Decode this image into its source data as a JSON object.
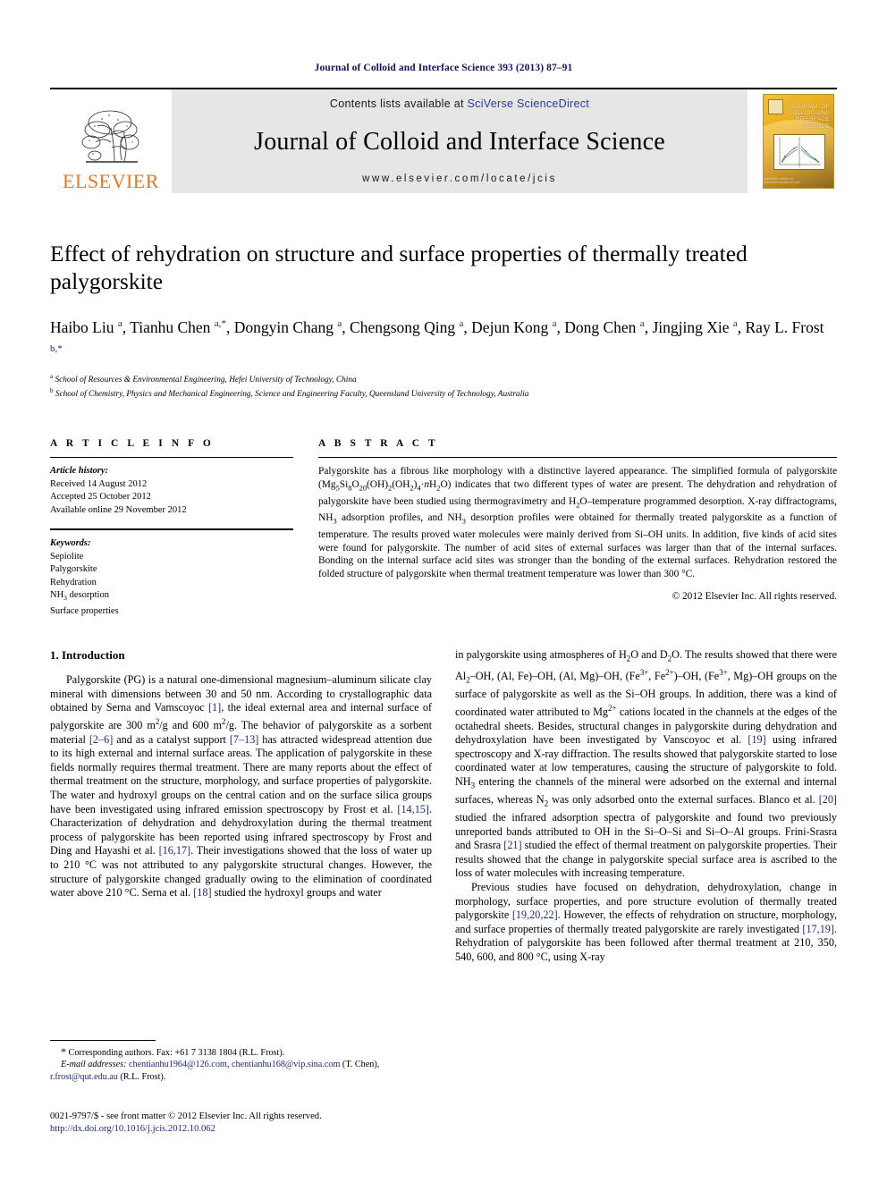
{
  "running_head": "Journal of Colloid and Interface Science 393 (2013) 87–91",
  "masthead": {
    "publisher_word": "ELSEVIER",
    "contents_prefix": "Contents lists available at ",
    "contents_link": "SciVerse ScienceDirect",
    "journal_title": "Journal of Colloid and Interface Science",
    "journal_url": "www.elsevier.com/locate/jcis",
    "cover_title": "JOURNAL OF\nCOLLOID AND\nINTERFACE\nSCIENCE",
    "cover_footer": "Available online at www.sciencedirect.com"
  },
  "article": {
    "title": "Effect of rehydration on structure and surface properties of thermally treated palygorskite",
    "authors_html": "Haibo Liu <sup>a</sup>, Tianhu Chen <sup>a,*</sup>, Dongyin Chang <sup>a</sup>, Chengsong Qing <sup>a</sup>, Dejun Kong <sup>a</sup>, Dong Chen <sup>a</sup>, Jingjing Xie <sup>a</sup>, Ray L. Frost <sup>b,*</sup>",
    "affiliations": [
      {
        "marker": "a",
        "text": "School of Resources & Environmental Engineering, Hefei University of Technology, China"
      },
      {
        "marker": "b",
        "text": "School of Chemistry, Physics and Mechanical Engineering, Science and Engineering Faculty, Queensland University of Technology, Australia"
      }
    ]
  },
  "article_info": {
    "heading": "A R T I C L E    I N F O",
    "history_label": "Article history:",
    "history": [
      "Received 14 August 2012",
      "Accepted 25 October 2012",
      "Available online 29 November 2012"
    ],
    "keywords_label": "Keywords:",
    "keywords_html": [
      "Sepiolite",
      "Palygorskite",
      "Rehydration",
      "NH<sub>3</sub> desorption",
      "Surface properties"
    ]
  },
  "abstract": {
    "heading": "A B S T R A C T",
    "text_html": "Palygorskite has a fibrous like morphology with a distinctive layered appearance. The simplified formula of palygorskite (Mg<sub>5</sub>Si<sub>8</sub>O<sub>20</sub>(OH)<sub>2</sub>(OH<sub>2</sub>)<sub>4</sub>·<i>n</i>H<sub>2</sub>O) indicates that two different types of water are present. The dehydration and rehydration of palygorskite have been studied using thermogravimetry and H<sub>2</sub>O–temperature programmed desorption. X-ray diffractograms, NH<sub>3</sub> adsorption profiles, and NH<sub>3</sub> desorption profiles were obtained for thermally treated palygorskite as a function of temperature. The results proved water molecules were mainly derived from Si–OH units. In addition, five kinds of acid sites were found for palygorskite. The number of acid sites of external surfaces was larger than that of the internal surfaces. Bonding on the internal surface acid sites was stronger than the bonding of the external surfaces. Rehydration restored the folded structure of palygorskite when thermal treatment temperature was lower than 300 °C.",
    "copyright": "© 2012 Elsevier Inc. All rights reserved."
  },
  "introduction": {
    "heading": "1. Introduction",
    "left_paragraph_html": "Palygorskite (PG) is a natural one-dimensional magnesium–aluminum silicate clay mineral with dimensions between 30 and 50 nm. According to crystallographic data obtained by Serna and Vamscoyoc <span class=\"ref\">[1]</span>, the ideal external area and internal surface of palygorskite are 300 m<sup>2</sup>/g and 600 m<sup>2</sup>/g. The behavior of palygorskite as a sorbent material <span class=\"ref\">[2–6]</span> and as a catalyst support <span class=\"ref\">[7–13]</span> has attracted widespread attention due to its high external and internal surface areas. The application of palygorskite in these fields normally requires thermal treatment. There are many reports about the effect of thermal treatment on the structure, morphology, and surface properties of palygorskite. The water and hydroxyl groups on the central cation and on the surface silica groups have been investigated using infrared emission spectroscopy by Frost et al. <span class=\"ref\">[14,15]</span>. Characterization of dehydration and dehydroxylation during the thermal treatment process of palygorskite has been reported using infrared spectroscopy by Frost and Ding and Hayashi et al. <span class=\"ref\">[16,17]</span>. Their investigations showed that the loss of water up to 210 °C was not attributed to any palygorskite structural changes. However, the structure of palygorskite changed gradually owing to the elimination of coordinated water above 210 °C. Serna et al. <span class=\"ref\">[18]</span> studied the hydroxyl groups and water",
    "right_paragraph_1_html": "in palygorskite using atmospheres of H<sub>2</sub>O and D<sub>2</sub>O. The results showed that there were Al<sub>2</sub>–OH, (Al, Fe)–OH, (Al, Mg)–OH, (Fe<sup>3+</sup>, Fe<sup>2+</sup>)–OH, (Fe<sup>3+</sup>, Mg)–OH groups on the surface of palygorskite as well as the Si–OH groups. In addition, there was a kind of coordinated water attributed to Mg<sup>2+</sup> cations located in the channels at the edges of the octahedral sheets. Besides, structural changes in palygorskite during dehydration and dehydroxylation have been investigated by Vanscoyoc et al. <span class=\"ref\">[19]</span> using infrared spectroscopy and X-ray diffraction. The results showed that palygorskite started to lose coordinated water at low temperatures, causing the structure of palygorskite to fold. NH<sub>3</sub> entering the channels of the mineral were adsorbed on the external and internal surfaces, whereas N<sub>2</sub> was only adsorbed onto the external surfaces. Blanco et al. <span class=\"ref\">[20]</span> studied the infrared adsorption spectra of palygorskite and found two previously unreported bands attributed to OH in the Si–O–Si and Si–O–Al groups. Frini-Srasra and Srasra <span class=\"ref\">[21]</span> studied the effect of thermal treatment on palygorskite properties. Their results showed that the change in palygorskite special surface area is ascribed to the loss of water molecules with increasing temperature.",
    "right_paragraph_2_html": "Previous studies have focused on dehydration, dehydroxylation, change in morphology, surface properties, and pore structure evolution of thermally treated palygorskite <span class=\"ref\">[19,20,22]</span>. However, the effects of rehydration on structure, morphology, and surface properties of thermally treated palygorskite are rarely investigated <span class=\"ref\">[17,19]</span>. Rehydration of palygorskite has been followed after thermal treatment at 210, 350, 540, 600, and 800 °C, using X-ray"
  },
  "footnotes": {
    "corresponding_html": "<span style=\"font-size:12px\">*</span> Corresponding authors. Fax: +61 7 3138 1804 (R.L. Frost).",
    "email_html": "<span class=\"it\">E-mail addresses:</span> <span class=\"mail\">chentianhu1964@126.com</span>, <span class=\"mail\">chentianhu168@vip.sina.com</span> (T. Chen), <span class=\"mail\">r.frost@qut.edu.au</span> (R.L. Frost)."
  },
  "imprint": {
    "line1_html": "0021-9797/$ - see front matter © 2012 Elsevier Inc. All rights reserved.",
    "doi": "http://dx.doi.org/10.1016/j.jcis.2012.10.062"
  }
}
